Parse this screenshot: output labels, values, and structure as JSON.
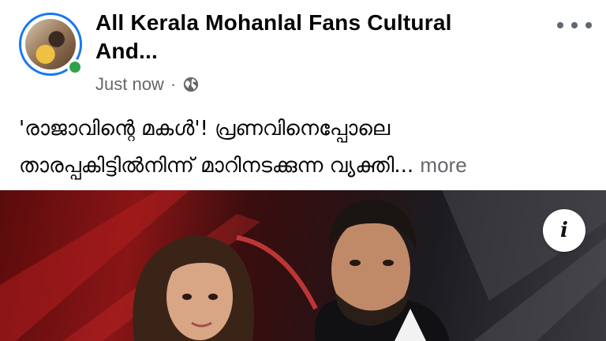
{
  "post": {
    "page_name": "All Kerala Mohanlal Fans Cultural And...",
    "timestamp": "Just now",
    "separator": "·",
    "privacy_icon": "globe-icon",
    "more_options_icon": "ellipsis-icon",
    "caption_line1": "'രാജാവിന്റെ മകൾ'! പ്രണവിനെപ്പോലെ",
    "caption_line2": "താരപ്പകിട്ടിൽനിന്ന് മാറിനടക്കുന്ന വ്യക്തി...",
    "see_more_label": "more",
    "info_icon_label": "i"
  },
  "colors": {
    "accent": "#1877f2",
    "online": "#31a24c",
    "secondary_text": "#65676b",
    "primary_text": "#050505"
  }
}
